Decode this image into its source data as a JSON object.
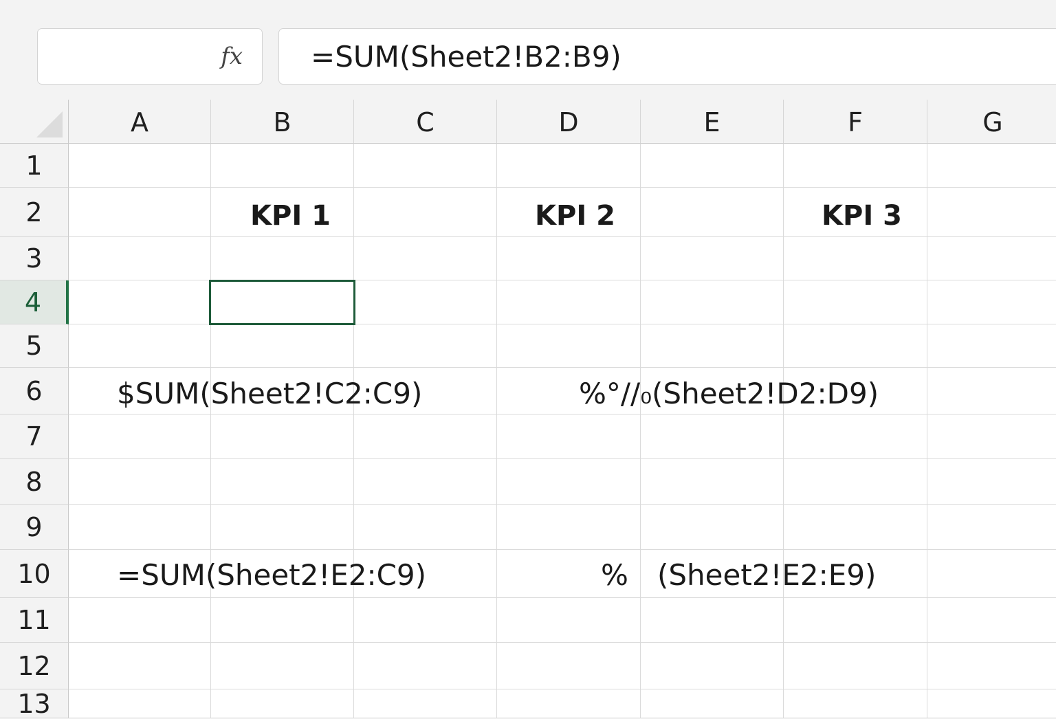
{
  "name_box": {
    "value": "",
    "fx_icon": "fx-icon"
  },
  "formula_bar": {
    "value": "=SUM(Sheet2!B2:B9)"
  },
  "columns": [
    "A",
    "B",
    "C",
    "D",
    "E",
    "F",
    "G"
  ],
  "rows": [
    "1",
    "2",
    "3",
    "4",
    "5",
    "6",
    "7",
    "8",
    "9",
    "10",
    "11",
    "12",
    "13"
  ],
  "active_cell": "B4",
  "cells": {
    "B2": "KPI 1",
    "D2": "KPI 2",
    "F2": "KPI 3",
    "A6": "$SUM(Sheet2!C2:C9)",
    "D6": "%°//₀(Sheet2!D2:D9)",
    "A10": "=SUM(Sheet2!E2:C9)",
    "D10": "%",
    "E10": "(Sheet2!E2:E9)"
  }
}
